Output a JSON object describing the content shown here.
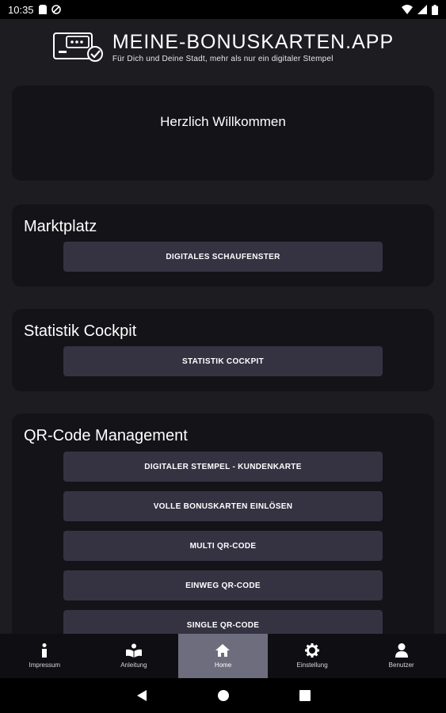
{
  "status": {
    "time": "10:35"
  },
  "header": {
    "brand": "MEINE-BONUSKARTEN.APP",
    "tagline": "Für Dich und Deine Stadt, mehr als nur ein digitaler Stempel"
  },
  "welcome": {
    "text": "Herzlich Willkommen"
  },
  "sections": {
    "marktplatz": {
      "title": "Marktplatz",
      "buttons": [
        "DIGITALES SCHAUFENSTER"
      ]
    },
    "statistik": {
      "title": "Statistik Cockpit",
      "buttons": [
        "STATISTIK COCKPIT"
      ]
    },
    "qr": {
      "title": "QR-Code Management",
      "buttons": [
        "DIGITALER STEMPEL - KUNDENKARTE",
        "VOLLE BONUSKARTEN EINLÖSEN",
        "MULTI QR-CODE",
        "EINWEG QR-CODE",
        "SINGLE QR-CODE"
      ]
    }
  },
  "bottom_nav": {
    "items": [
      {
        "label": "Impressum",
        "icon": "info-icon"
      },
      {
        "label": "Anleitung",
        "icon": "book-icon"
      },
      {
        "label": "Home",
        "icon": "home-icon"
      },
      {
        "label": "Einstellung",
        "icon": "gear-icon"
      },
      {
        "label": "Benutzer",
        "icon": "user-icon"
      }
    ],
    "active": "Home"
  },
  "colors": {
    "background": "#1c1c21",
    "card": "#131318",
    "button": "#353342",
    "nav_active": "#6e6d7e"
  }
}
